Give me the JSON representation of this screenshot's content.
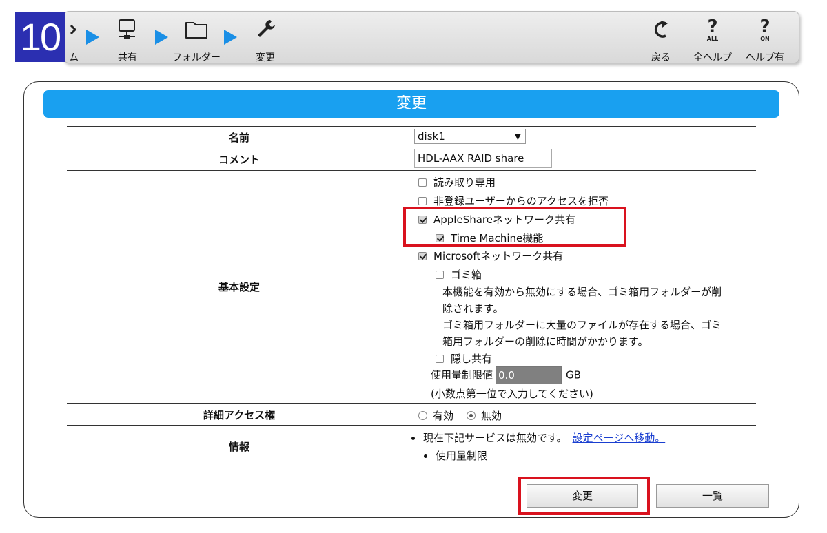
{
  "step_number": "10",
  "toolbar": {
    "crumbs": [
      {
        "icon": "system-icon",
        "label": "ム"
      },
      {
        "icon": "share-icon",
        "label": "共有"
      },
      {
        "icon": "folder-icon",
        "label": "フォルダー"
      },
      {
        "icon": "wrench-icon",
        "label": "変更"
      }
    ],
    "actions": [
      {
        "icon": "back-arrow-icon",
        "label": "戻る"
      },
      {
        "icon": "help-all-icon",
        "label": "全ヘルプ",
        "badge": "ALL"
      },
      {
        "icon": "help-on-icon",
        "label": "ヘルプ有",
        "badge": "ON"
      }
    ]
  },
  "panel": {
    "title": "変更",
    "name_label": "名前",
    "name_value": "disk1",
    "comment_label": "コメント",
    "comment_value": "HDL-AAX RAID share",
    "basic_label": "基本設定",
    "options": {
      "read_only": {
        "label": "読み取り専用",
        "checked": false
      },
      "deny_guest": {
        "label": "非登録ユーザーからのアクセスを拒否",
        "checked": false
      },
      "appleshare": {
        "label": "AppleShareネットワーク共有",
        "checked": true
      },
      "time_machine": {
        "label": "Time Machine機能",
        "checked": true
      },
      "microsoft": {
        "label": "Microsoftネットワーク共有",
        "checked": true
      },
      "trash": {
        "label": "ゴミ箱",
        "checked": false
      },
      "hidden": {
        "label": "隠し共有",
        "checked": false
      }
    },
    "trash_note": [
      "本機能を有効から無効にする場合、ゴミ箱用フォルダーが削",
      "除されます。",
      "ゴミ箱用フォルダーに大量のファイルが存在する場合、ゴミ",
      "箱用フォルダーの削除に時間がかかります。"
    ],
    "quota_label": "使用量制限値",
    "quota_value": "0.0",
    "quota_unit": "GB",
    "quota_hint": "(小数点第一位で入力してください)",
    "acl_label": "詳細アクセス権",
    "acl_options": [
      {
        "label": "有効",
        "selected": false
      },
      {
        "label": "無効",
        "selected": true
      }
    ],
    "info_label": "情報",
    "info_text": "現在下記サービスは無効です。",
    "info_link": "設定ページへ移動。",
    "info_item": "使用量制限",
    "buttons": {
      "change": "変更",
      "list": "一覧"
    }
  },
  "colors": {
    "accent": "#19a0f0",
    "badge": "#2b2fb1",
    "highlight": "#d9121e",
    "arrow": "#1a8fe6"
  }
}
